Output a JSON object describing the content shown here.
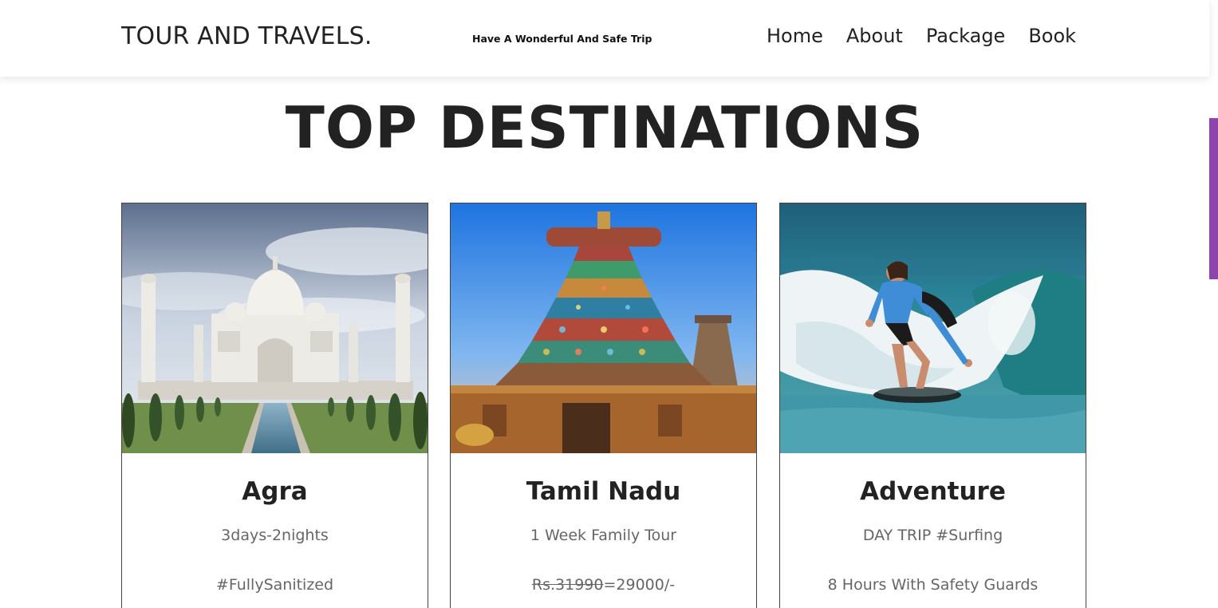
{
  "header": {
    "brand": "TOUR AND TRAVELS.",
    "tagline": "Have A Wonderful And Safe Trip",
    "nav": [
      {
        "label": "Home"
      },
      {
        "label": "About"
      },
      {
        "label": "Package"
      },
      {
        "label": "Book"
      }
    ]
  },
  "section": {
    "title": "TOP DESTINATIONS"
  },
  "cards": [
    {
      "title": "Agra",
      "subtitle": "3days-2nights",
      "extra": "#FullySanitized",
      "image": "taj-mahal-photo"
    },
    {
      "title": "Tamil Nadu",
      "subtitle": "1 Week Family Tour",
      "old_price": "Rs.31990",
      "new_price": "=29000/-",
      "image": "temple-gopuram-photo"
    },
    {
      "title": "Adventure",
      "subtitle": "DAY TRIP #Surfing",
      "extra": "8 Hours With Safety Guards",
      "image": "surfing-photo"
    }
  ],
  "colors": {
    "accent": "#8e44ad",
    "text": "#222222",
    "muted": "#666666"
  }
}
